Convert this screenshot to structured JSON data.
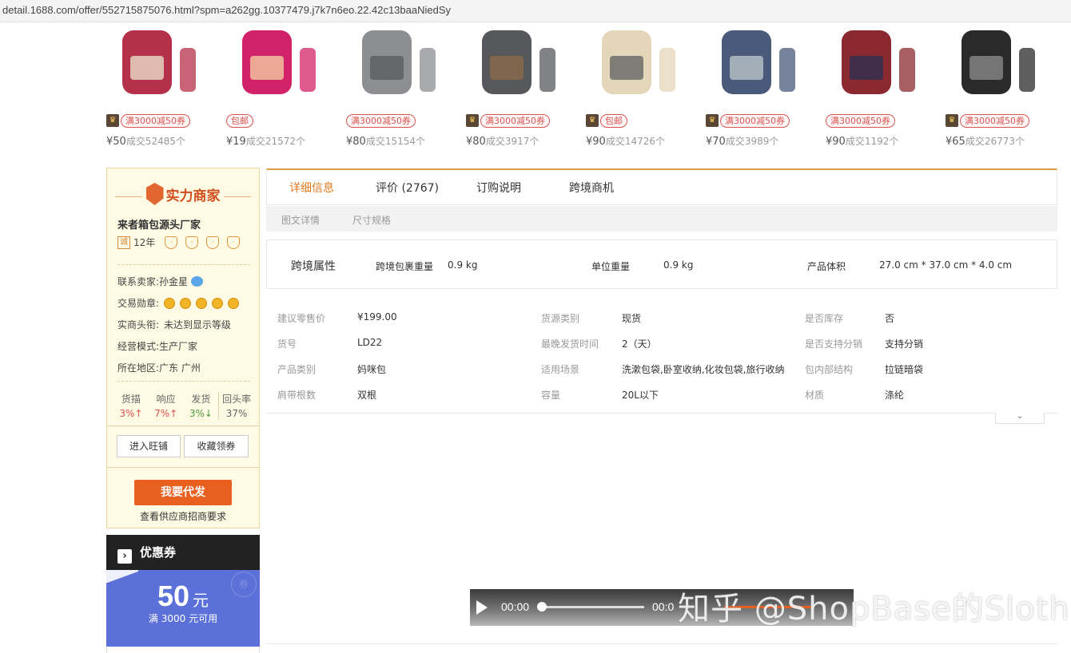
{
  "browser": {
    "url": "detail.1688.com/offer/552715875076.html?spm=a262gg.10377479.j7k7n6eo.22.42c13baaNiedSy"
  },
  "products": [
    {
      "tag": "满3000减50券",
      "price": "¥50",
      "sales": "成交52485个",
      "crown": true,
      "img": "pink-backpack-with-changing-mat",
      "c1": "#b5304a",
      "c2": "#e8dcc6"
    },
    {
      "tag": "包邮",
      "price": "¥19",
      "sales": "成交21572个",
      "crown": false,
      "img": "magenta-tote-bag",
      "c1": "#d2236a",
      "c2": "#f2c8a0"
    },
    {
      "tag": "满3000减50券",
      "price": "¥80",
      "sales": "成交15154个",
      "crown": false,
      "img": "grey-backpack",
      "c1": "#8c8e92",
      "c2": "#5a5c60"
    },
    {
      "tag": "满3000减50券",
      "price": "¥80",
      "sales": "成交3917个",
      "crown": true,
      "img": "dark-grey-backpack",
      "c1": "#56585c",
      "c2": "#8a6a4a"
    },
    {
      "tag": "包邮",
      "price": "¥90",
      "sales": "成交14726个",
      "crown": true,
      "img": "backpack-bassinet",
      "c1": "#e4d6b8",
      "c2": "#666"
    },
    {
      "tag": "满3000减50券",
      "price": "¥70",
      "sales": "成交3989个",
      "crown": true,
      "img": "model-wearing-backpack",
      "c1": "#4a5a7a",
      "c2": "#b8c4c8"
    },
    {
      "tag": "满3000减50券",
      "price": "¥90",
      "sales": "成交1192个",
      "crown": false,
      "img": "backpack-color-variants",
      "c1": "#8a2a30",
      "c2": "#2a3050"
    },
    {
      "tag": "满3000减50券",
      "price": "¥65",
      "sales": "成交26773个",
      "crown": true,
      "img": "black-backpack",
      "c1": "#2a2a2a",
      "c2": "#888"
    }
  ],
  "seller": {
    "badge": "实力商家",
    "name": "来者箱包源头厂家",
    "cheng": "诚",
    "years": "12年",
    "contact_label": "联系卖家:",
    "contact_name": "孙金星",
    "medal_label": "交易勋章:",
    "rank_label": "实商头衔:",
    "rank_value": "未达到显示等级",
    "mode_label": "经营模式:",
    "mode_value": "生产厂家",
    "region_label": "所在地区:",
    "region_value": "广东 广州",
    "stats": [
      {
        "label": "货描",
        "value": "3%↑",
        "dir": "up"
      },
      {
        "label": "响应",
        "value": "7%↑",
        "dir": "up"
      },
      {
        "label": "发货",
        "value": "3%↓",
        "dir": "down"
      },
      {
        "label": "回头率",
        "value": "37%",
        "dir": "none"
      }
    ],
    "btn_shop": "进入旺铺",
    "btn_fav": "收藏领券",
    "btn_dropship": "我要代发",
    "dropship_note": "查看供应商招商要求"
  },
  "coupon": {
    "title": "优惠券",
    "amount": "50",
    "unit": "元",
    "condition": "满 3000 元可用",
    "stamp": "券"
  },
  "tabs": [
    {
      "label": "详细信息",
      "active": true
    },
    {
      "label": "评价 (2767)",
      "active": false
    },
    {
      "label": "订购说明",
      "active": false
    },
    {
      "label": "跨境商机",
      "active": false
    }
  ],
  "subtabs": [
    "图文详情",
    "尺寸规格"
  ],
  "crossborder": {
    "title": "跨境属性",
    "items": [
      {
        "k": "跨境包裹重量",
        "v": "0.9 kg"
      },
      {
        "k": "单位重量",
        "v": "0.9 kg"
      },
      {
        "k": "产品体积",
        "v": "27.0 cm * 37.0 cm * 4.0 cm"
      }
    ]
  },
  "attributes": [
    [
      {
        "k": "建议零售价",
        "v": "¥199.00"
      },
      {
        "k": "货源类别",
        "v": "现货"
      },
      {
        "k": "是否库存",
        "v": "否"
      }
    ],
    [
      {
        "k": "货号",
        "v": "LD22"
      },
      {
        "k": "最晚发货时间",
        "v": "2（天）"
      },
      {
        "k": "是否支持分销",
        "v": "支持分销"
      }
    ],
    [
      {
        "k": "产品类别",
        "v": "妈咪包"
      },
      {
        "k": "适用场景",
        "v": "洗漱包袋,卧室收纳,化妆包袋,旅行收纳"
      },
      {
        "k": "包内部结构",
        "v": "拉链暗袋"
      }
    ],
    [
      {
        "k": "肩带根数",
        "v": "双根"
      },
      {
        "k": "容量",
        "v": "20L以下"
      },
      {
        "k": "材质",
        "v": "涤纶"
      }
    ]
  ],
  "video": {
    "current_time": "00:00",
    "total_time": "00:0"
  },
  "watermark": "知乎 @ShopBase的Sloth"
}
